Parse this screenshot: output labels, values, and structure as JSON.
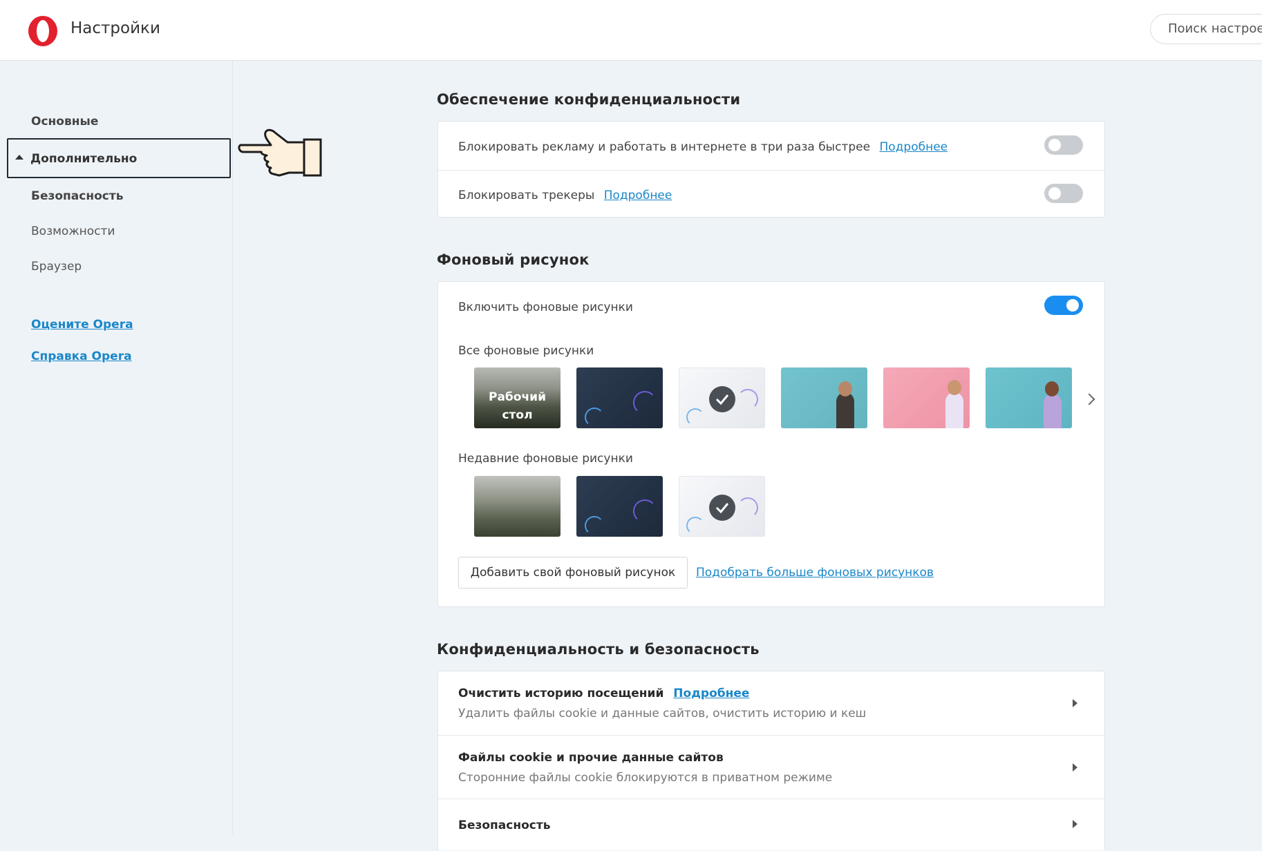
{
  "header": {
    "title": "Настройки",
    "search_placeholder": "Поиск настроек"
  },
  "colors": {
    "accent": "#1a87c9",
    "toggle_on": "#1a8ef0",
    "brand_red": "#e3202d"
  },
  "sidebar": {
    "items": [
      {
        "label": "Основные"
      },
      {
        "label": "Дополнительно",
        "expanded": true
      },
      {
        "label": "Безопасность"
      },
      {
        "label": "Возможности"
      },
      {
        "label": "Браузер"
      }
    ],
    "links": [
      "Оцените Opera",
      "Справка Opera"
    ]
  },
  "privacy": {
    "title": "Обеспечение конфиденциальности",
    "rows": [
      {
        "label": "Блокировать рекламу и работать в интернете в три раза быстрее",
        "link": "Подробнее",
        "enabled": false
      },
      {
        "label": "Блокировать трекеры",
        "link": "Подробнее",
        "enabled": false
      }
    ]
  },
  "wallpaper": {
    "title": "Фоновый рисунок",
    "enable_label": "Включить фоновые рисунки",
    "enabled": true,
    "all_label": "Все фоновые рисунки",
    "desktop_label": "Рабочий стол",
    "recent_label": "Недавние фоновые рисунки",
    "add_button": "Добавить свой фоновый рисунок",
    "more_link": "Подобрать больше фоновых рисунков"
  },
  "security": {
    "title": "Конфиденциальность и безопасность",
    "rows": [
      {
        "title": "Очистить историю посещений",
        "link": "Подробнее",
        "subtitle": "Удалить файлы cookie и данные сайтов, очистить историю и кеш"
      },
      {
        "title": "Файлы cookie и прочие данные сайтов",
        "subtitle": "Сторонние файлы cookie блокируются в приватном режиме"
      },
      {
        "title": "Безопасность"
      }
    ]
  }
}
